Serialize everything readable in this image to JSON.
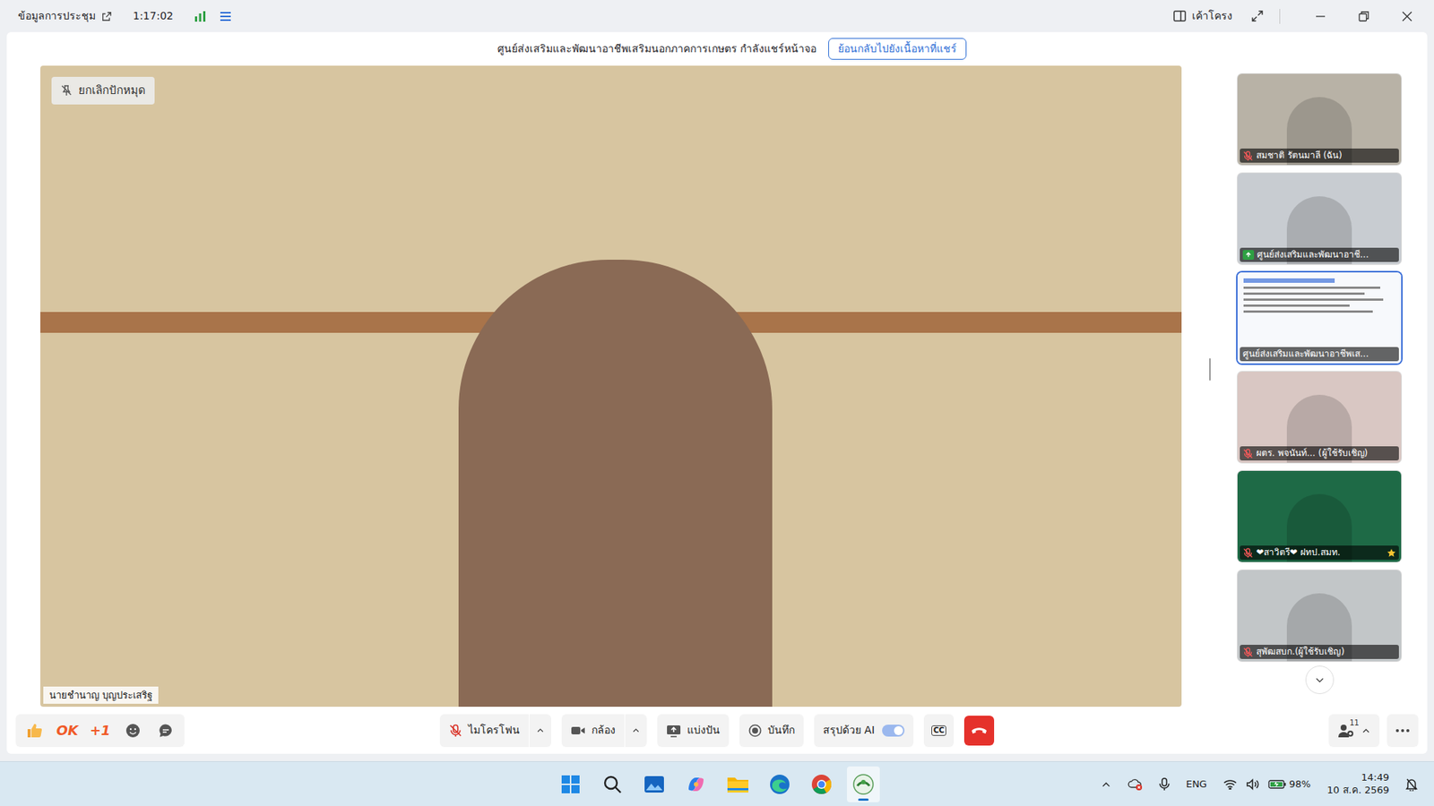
{
  "window": {
    "title": "ข้อมูลการประชุม",
    "elapsed": "1:17:02",
    "layout": "เค้าโครง"
  },
  "share_banner": {
    "text": "ศูนย์ส่งเสริมและพัฒนาอาชีพเสริมนอกภาคการเกษตร กำลังแชร์หน้าจอ",
    "button": "ย้อนกลับไปยังเนื้อหาที่แชร์"
  },
  "main_video": {
    "pin_button": "ยกเลิกปักหมุด",
    "name": "นายชำนาญ บุญประเสริฐ"
  },
  "participants": [
    {
      "name": "สมชาติ รัตนมาลี (ฉัน)",
      "kind": "camera",
      "muted": true,
      "presenting": false,
      "selected": false,
      "starred": false
    },
    {
      "name": "ศูนย์ส่งเสริมและพัฒนาอาชี...",
      "kind": "camera",
      "muted": false,
      "presenting": true,
      "selected": false,
      "starred": false
    },
    {
      "name": "ศูนย์ส่งเสริมและพัฒนาอาชีพเส...",
      "kind": "screen",
      "muted": false,
      "presenting": false,
      "selected": true,
      "starred": false
    },
    {
      "name": "ผตร. พจนันท์... (ผู้ใช้รับเชิญ)",
      "kind": "camera",
      "muted": true,
      "presenting": false,
      "selected": false,
      "starred": false
    },
    {
      "name": "❤สาวิตรี❤ ฝทป.สมท.",
      "kind": "camera",
      "muted": true,
      "presenting": false,
      "selected": false,
      "starred": true
    },
    {
      "name": "สุพัฒสบก.(ผู้ใช้รับเชิญ)",
      "kind": "camera",
      "muted": true,
      "presenting": false,
      "selected": false,
      "starred": false
    }
  ],
  "reactions": [
    {
      "kind": "like"
    },
    {
      "kind": "text",
      "label": "OK"
    },
    {
      "kind": "text",
      "label": "+1"
    },
    {
      "kind": "emoji"
    },
    {
      "kind": "chat"
    }
  ],
  "controls": [
    {
      "kind": "mic",
      "label": "ไมโครโฟน",
      "muted": true,
      "dropdown": true
    },
    {
      "kind": "camera",
      "label": "กล้อง",
      "muted": false,
      "dropdown": true
    },
    {
      "kind": "share",
      "label": "แบ่งปัน"
    },
    {
      "kind": "record",
      "label": "บันทึก"
    },
    {
      "kind": "toggle",
      "label": "สรุปด้วย AI",
      "on": true
    },
    {
      "kind": "cc",
      "label": "CC"
    },
    {
      "kind": "hangup"
    }
  ],
  "participants_count": "11",
  "taskbar": {
    "apps": [
      {
        "selected": false
      },
      {
        "selected": false
      },
      {
        "selected": false
      },
      {
        "selected": false
      },
      {
        "selected": false
      },
      {
        "selected": false
      },
      {
        "selected": false
      },
      {
        "selected": true
      }
    ],
    "tray": {
      "language": "ENG",
      "battery": "98%",
      "time": "14:49",
      "date": "10 ส.ค. 2569"
    }
  }
}
